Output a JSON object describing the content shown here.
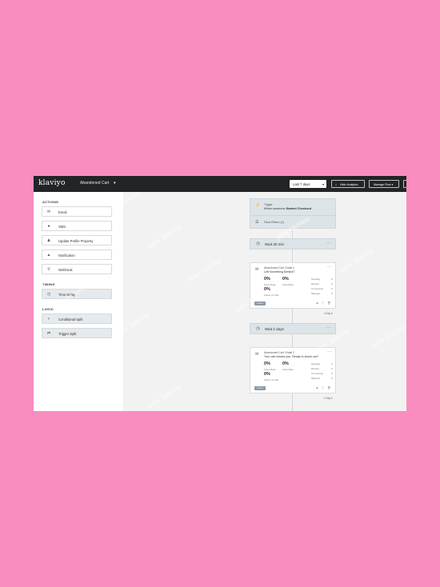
{
  "header": {
    "logo": "klaviyo",
    "flow_name": "Abandoned Cart",
    "flow_caret": "▾",
    "date_range": "Last 7 days",
    "date_caret": "▾",
    "hide_analytics": "Hide Analytics",
    "manage_flow": "Manage Flow ▾"
  },
  "sidebar": {
    "actions_title": "ACTIONS",
    "actions": [
      {
        "label": "Email",
        "icon": "envelope-icon"
      },
      {
        "label": "SMS",
        "icon": "chat-icon"
      },
      {
        "label": "Update Profile Property",
        "icon": "person-icon"
      },
      {
        "label": "Notification",
        "icon": "bell-icon"
      },
      {
        "label": "Webhook",
        "icon": "webhook-icon"
      }
    ],
    "timing_title": "TIMING",
    "timing": [
      {
        "label": "Time Delay",
        "icon": "clock-icon"
      }
    ],
    "logic_title": "LOGIC",
    "logic": [
      {
        "label": "Conditional Split",
        "icon": "split-icon"
      },
      {
        "label": "Trigger Split",
        "icon": "trigger-split-icon"
      }
    ]
  },
  "flow": {
    "trigger": {
      "label": "Trigger",
      "text_prefix": "When someone",
      "text_bold": "Started Checkout",
      "filters": "Flow Filters (1)"
    },
    "wait1": "Wait 30 min",
    "email1": {
      "name": "Abandoned Cart: Email 1",
      "subject": "Left Something Behind?",
      "open_rate": "0%",
      "open_rate_label": "Open Rate",
      "click_rate": "0%",
      "click_rate_label": "Click Rate",
      "third": "0%",
      "third_label": "Active on Site",
      "stats": [
        "Sending",
        "Review",
        "Conversion",
        "Skipped"
      ],
      "stat_values": [
        "0",
        "0",
        "0",
        "0"
      ],
      "status": "Live ▾",
      "day": "▾ Day 0"
    },
    "wait2": "Wait 2 days",
    "email2": {
      "name": "Abandoned Cart: Email 2",
      "subject": "Your cart misses you. Ready to check out?",
      "open_rate": "0%",
      "open_rate_label": "Open Rate",
      "click_rate": "0%",
      "click_rate_label": "Click Rate",
      "third": "0%",
      "third_label": "Active on Site",
      "stats": [
        "Sending",
        "Review",
        "Conversion",
        "Skipped"
      ],
      "stat_values": [
        "0",
        "0",
        "0",
        "0"
      ],
      "status": "Live ▾",
      "day": "▾ Day 2"
    }
  },
  "watermark": "jane laurino",
  "colors": {
    "background": "#f98dc0",
    "topbar": "#232426",
    "accent_button": "#1a9e53"
  }
}
